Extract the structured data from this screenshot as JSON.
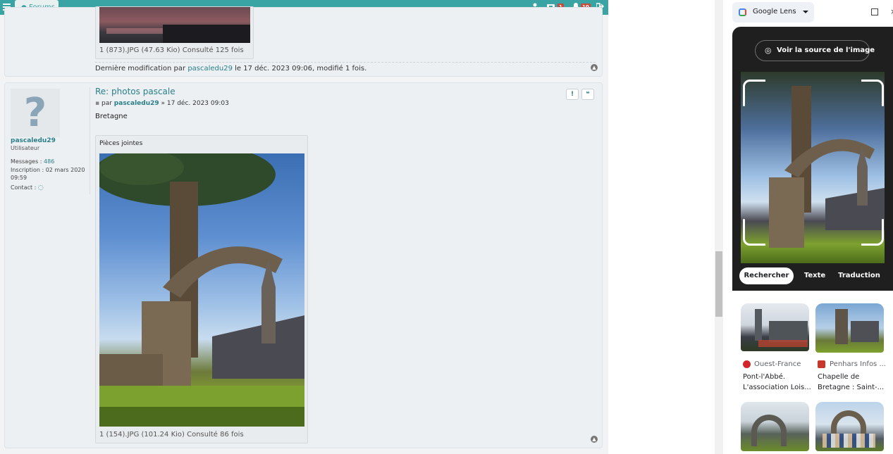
{
  "forum": {
    "tab_label": "Forums",
    "badges": {
      "messages": "1",
      "notifications": "10"
    },
    "post_prev": {
      "attachment_caption": "1 (873).JPG (47.63 Kio) Consulté 125 fois",
      "edit_prefix": "Dernière modification par",
      "edit_user": "pascaledu29",
      "edit_suffix": "le 17 déc. 2023 09:06, modifié 1 fois."
    },
    "post": {
      "title": "Re: photos pascale",
      "by_label": "par",
      "author": "pascaledu29",
      "date": "» 17 déc. 2023 09:03",
      "body": "Bretagne",
      "attachments_title": "Pièces jointes",
      "attachment_caption": "1 (154).JPG (101.24 Kio) Consulté 86 fois",
      "report_label": "!",
      "quote_label": "❝"
    },
    "profile": {
      "username": "pascaledu29",
      "rank": "Utilisateur",
      "messages_label": "Messages :",
      "messages_count": "486",
      "joined_label": "Inscription : 02 mars 2020",
      "joined_time": "09:59",
      "contact_label": "Contact :"
    }
  },
  "lens": {
    "title": "Google Lens",
    "source_button": "Voir la source de l'image",
    "tabs": [
      "Rechercher",
      "Texte",
      "Traduction"
    ],
    "results": [
      {
        "source": "Ouest-France",
        "title_line1": "Pont-l'Abbé.",
        "title_line2": "L'association Lois..."
      },
      {
        "source": "Penhars Infos ...",
        "title_line1": "Chapelle de",
        "title_line2": "Bretagne : Saint-..."
      }
    ]
  },
  "colors": {
    "accent": "#3aa3a3",
    "link": "#2a7f88",
    "badge": "#c9483b",
    "lens_dark": "#1f1f1f"
  },
  "icons": [
    "menu-icon",
    "chat-bubble-icon",
    "user-icon",
    "inbox-icon",
    "bell-icon",
    "logout-icon",
    "post-icon",
    "back-to-top-icon",
    "lens-icon",
    "dropdown-icon",
    "open-in-new-icon",
    "close-icon"
  ]
}
